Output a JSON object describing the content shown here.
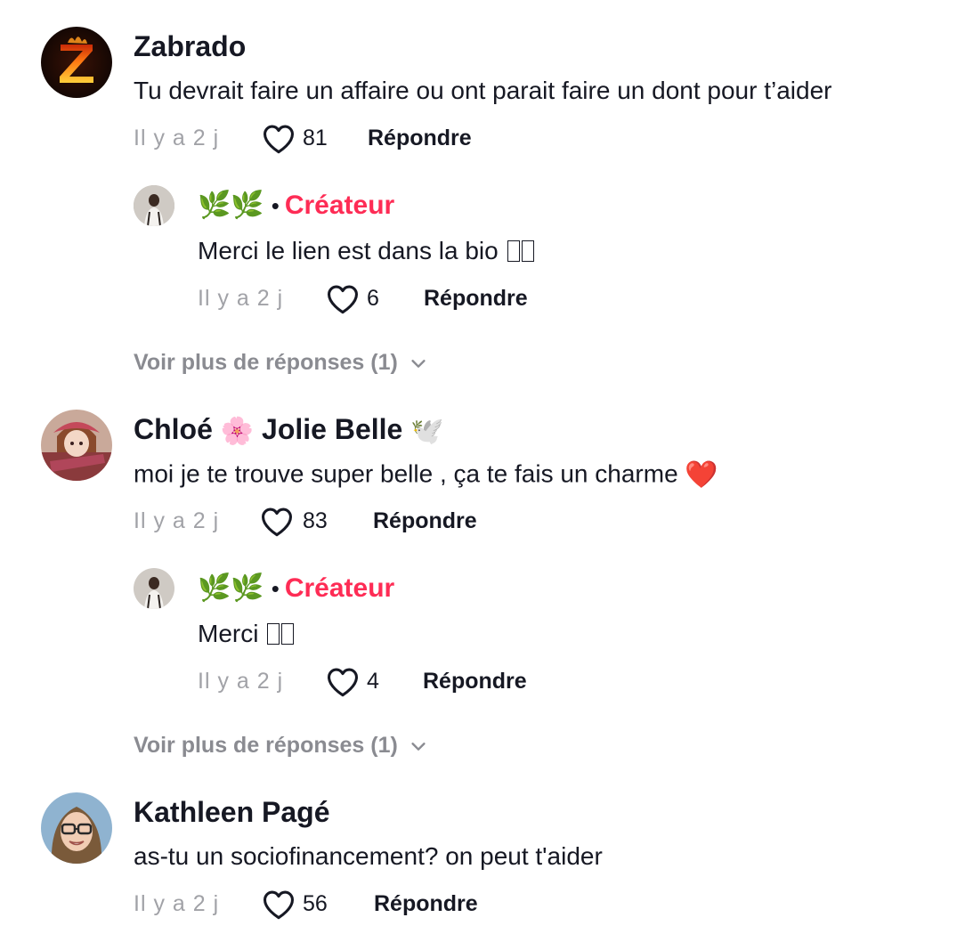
{
  "comments": [
    {
      "username": "Zabrado",
      "text": "Tu devrait faire un affaire ou ont parait faire un dont pour t’aider",
      "time": "Il y a 2 j",
      "likes": "81",
      "reply_label": "Répondre",
      "avatar_letter": "Z",
      "reply": {
        "name_emoji": "🌿🌿",
        "creator_label": "Créateur",
        "text": "Merci le lien est dans la bio",
        "time": "Il y a 2 j",
        "likes": "6",
        "reply_label": "Répondre"
      },
      "more_replies": "Voir plus de réponses (1)"
    },
    {
      "username_part1": "Chloé",
      "username_emoji1": "🌸",
      "username_part2": "Jolie Belle",
      "username_emoji2": "🕊️",
      "text": "moi je te trouve super belle , ça te fais un charme",
      "text_emoji": "❤️",
      "time": "Il y a 2 j",
      "likes": "83",
      "reply_label": "Répondre",
      "reply": {
        "name_emoji": "🌿🌿",
        "creator_label": "Créateur",
        "text": "Merci",
        "time": "Il y a 2 j",
        "likes": "4",
        "reply_label": "Répondre"
      },
      "more_replies": "Voir plus de réponses (1)"
    },
    {
      "username": "Kathleen Pagé",
      "text": "as-tu un sociofinancement? on peut t'aider",
      "time": "Il y a 2 j",
      "likes": "56",
      "reply_label": "Répondre"
    }
  ],
  "colors": {
    "text_primary": "#161823",
    "text_secondary": "#a1a2a7",
    "creator_accent": "#fe2c55",
    "more_replies": "#8a8b91"
  },
  "icons": {
    "like": "heart-outline-icon",
    "expand": "chevron-down-icon"
  }
}
